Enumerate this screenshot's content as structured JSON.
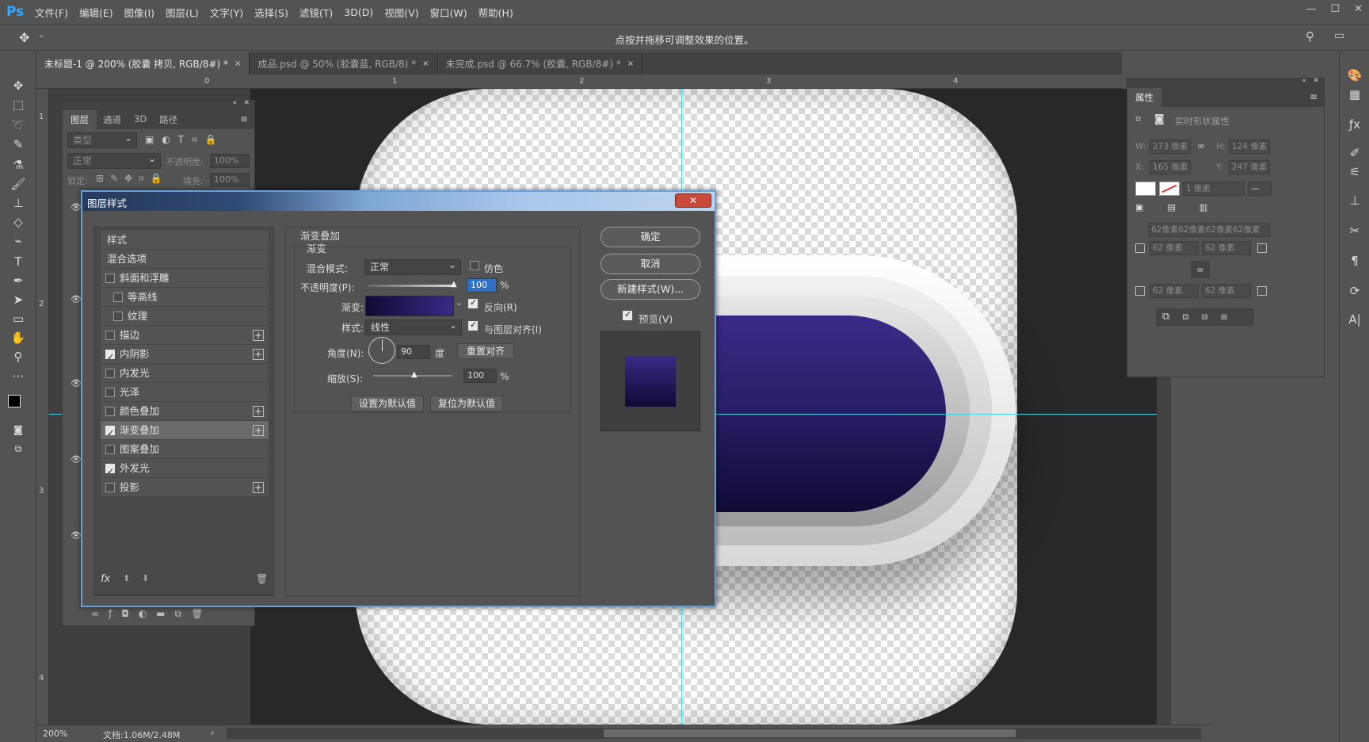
{
  "app": {
    "logo": "Ps"
  },
  "menu": [
    "文件(F)",
    "编辑(E)",
    "图像(I)",
    "图层(L)",
    "文字(Y)",
    "选择(S)",
    "滤镜(T)",
    "3D(D)",
    "视图(V)",
    "窗口(W)",
    "帮助(H)"
  ],
  "options_bar": {
    "hint": "点按并拖移可调整效果的位置。"
  },
  "tabs": [
    {
      "label": "未标题-1 @ 200% (胶囊 拷贝, RGB/8#) *",
      "close": "×"
    },
    {
      "label": "成品.psd @ 50% (胶囊蓝, RGB/8) *",
      "close": "×"
    },
    {
      "label": "未完成.psd @ 66.7% (胶囊, RGB/8#) *",
      "close": "×"
    }
  ],
  "rulers": {
    "top": [
      "0",
      "1",
      "2",
      "3",
      "4"
    ],
    "left": [
      "1",
      "2",
      "3",
      "4"
    ]
  },
  "status": {
    "zoom": "200%",
    "doc": "文档:1.06M/2.48M"
  },
  "layers_panel": {
    "tabs": [
      "图层",
      "通道",
      "3D",
      "路径"
    ],
    "filter_placeholder": "类型",
    "blend": "正常",
    "opacity_label": "不透明度:",
    "opacity": "100%",
    "lock_label": "锁定:",
    "fill_label": "填充:",
    "fill": "100%"
  },
  "properties_panel": {
    "title": "属性",
    "subtitle": "实时形状属性",
    "w_label": "W:",
    "w": "273 像素",
    "h_label": "H:",
    "h": "124 像素",
    "x_label": "X:",
    "x": "165 像素",
    "y_label": "Y:",
    "y": "247 像素",
    "stroke_width": "1 像素",
    "corners_combined": "62像素62像素62像素62像素",
    "corner_tl": "62 像素",
    "corner_tr": "62 像素",
    "corner_bl": "62 像素",
    "corner_br": "62 像素"
  },
  "dialog": {
    "title": "图层样式",
    "close": "✕",
    "styles_header": "样式",
    "blend_options": "混合选项",
    "effects": [
      {
        "label": "斜面和浮雕",
        "checked": false,
        "plus": false,
        "indent": false
      },
      {
        "label": "等高线",
        "checked": false,
        "plus": false,
        "indent": true
      },
      {
        "label": "纹理",
        "checked": false,
        "plus": false,
        "indent": true
      },
      {
        "label": "描边",
        "checked": false,
        "plus": true,
        "indent": false
      },
      {
        "label": "内阴影",
        "checked": true,
        "plus": true,
        "indent": false
      },
      {
        "label": "内发光",
        "checked": false,
        "plus": false,
        "indent": false
      },
      {
        "label": "光泽",
        "checked": false,
        "plus": false,
        "indent": false
      },
      {
        "label": "颜色叠加",
        "checked": false,
        "plus": true,
        "indent": false
      },
      {
        "label": "渐变叠加",
        "checked": true,
        "plus": true,
        "indent": false,
        "selected": true
      },
      {
        "label": "图案叠加",
        "checked": false,
        "plus": false,
        "indent": false
      },
      {
        "label": "外发光",
        "checked": true,
        "plus": false,
        "indent": false
      },
      {
        "label": "投影",
        "checked": false,
        "plus": true,
        "indent": false
      }
    ],
    "section_title": "渐变叠加",
    "group_title": "渐变",
    "blend_mode_label": "混合模式:",
    "blend_mode": "正常",
    "dither_label": "仿色",
    "opacity_label": "不透明度(P):",
    "opacity": "100",
    "percent": "%",
    "gradient_label": "渐变:",
    "reverse_label": "反向(R)",
    "style_label": "样式:",
    "style": "线性",
    "align_label": "与图层对齐(I)",
    "angle_label": "角度(N):",
    "angle": "90",
    "degree": "度",
    "reset_align": "重置对齐",
    "scale_label": "缩放(S):",
    "scale": "100",
    "set_default": "设置为默认值",
    "reset_default": "复位为默认值",
    "ok": "确定",
    "cancel": "取消",
    "new_style": "新建样式(W)...",
    "preview_label": "预览(V)",
    "fx": "fx"
  },
  "colors": {
    "gradient_dark": "#100a35",
    "gradient_light": "#3a2a86",
    "guide": "#3fd4e8",
    "ps_blue": "#31a8ff"
  }
}
